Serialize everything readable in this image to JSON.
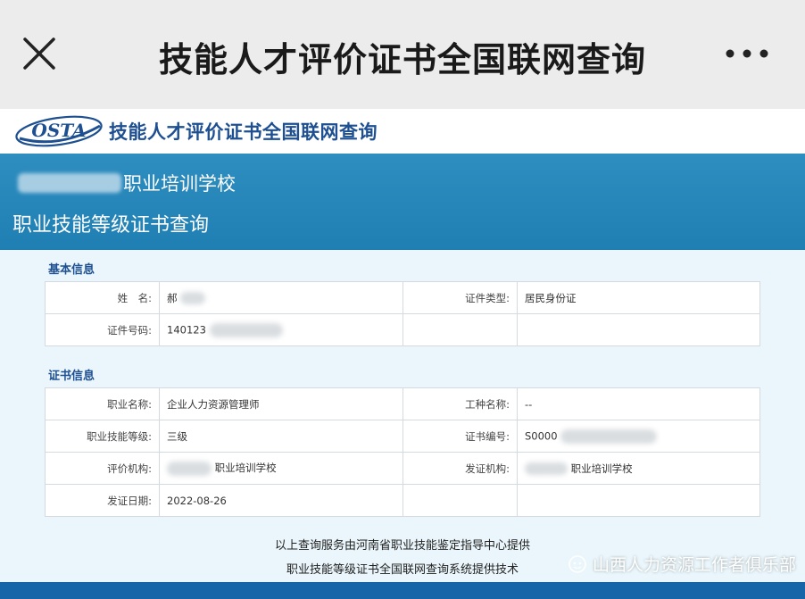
{
  "topbar": {
    "title": "技能人才评价证书全国联网查询",
    "close_icon": "close-icon",
    "more_icon": "more-dots-icon"
  },
  "logo": {
    "badge_text": "OSTA",
    "site_name": "技能人才评价证书全国联网查询"
  },
  "banner": {
    "school_suffix": "职业培训学校",
    "subtitle": "职业技能等级证书查询"
  },
  "basic_info": {
    "title": "基本信息",
    "rows": [
      {
        "label1": "姓　名:",
        "value1": "郝",
        "label2": "证件类型:",
        "value2": "居民身份证"
      },
      {
        "label1": "证件号码:",
        "value1": "140123",
        "label2": "",
        "value2": ""
      }
    ]
  },
  "cert_info": {
    "title": "证书信息",
    "rows": [
      {
        "label1": "职业名称:",
        "value1": "企业人力资源管理师",
        "label2": "工种名称:",
        "value2": "--"
      },
      {
        "label1": "职业技能等级:",
        "value1": "三级",
        "label2": "证书编号:",
        "value2": "S0000"
      },
      {
        "label1": "评价机构:",
        "value1": "职业培训学校",
        "label2": "发证机构:",
        "value2": "职业培训学校"
      },
      {
        "label1": "发证日期:",
        "value1": "2022-08-26",
        "label2": "",
        "value2": ""
      }
    ]
  },
  "footer": {
    "line1": "以上查询服务由河南省职业技能鉴定指导中心提供",
    "line2": "职业技能等级证书全国联网查询系统提供技术"
  },
  "watermark": {
    "text": "山西人力资源工作者俱乐部"
  },
  "colors": {
    "banner": "#1f7fb3",
    "brand_blue": "#1d4f91",
    "content_bg": "#eaf6fb",
    "bottom_bar": "#1565a8"
  }
}
